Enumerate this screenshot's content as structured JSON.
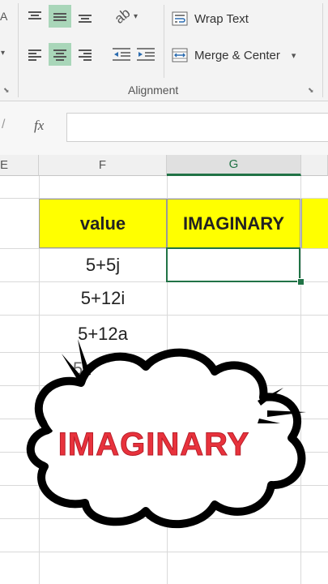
{
  "ribbon": {
    "wrap_text_label": "Wrap Text",
    "merge_center_label": "Merge & Center",
    "group_label": "Alignment"
  },
  "formula_bar": {
    "fx_label": "fx",
    "value": ""
  },
  "columns": [
    "E",
    "F",
    "G"
  ],
  "table": {
    "headers": [
      "value",
      "IMAGINARY"
    ],
    "rows": [
      "5+5j",
      "5+12i",
      "5+12a",
      "5+1"
    ]
  },
  "overlay": {
    "title": "IMAGINARY",
    "title_color": "#e8323c"
  },
  "colors": {
    "accent": "#217346",
    "header_fill": "#ffff00",
    "active_button": "#a9d6b9"
  }
}
